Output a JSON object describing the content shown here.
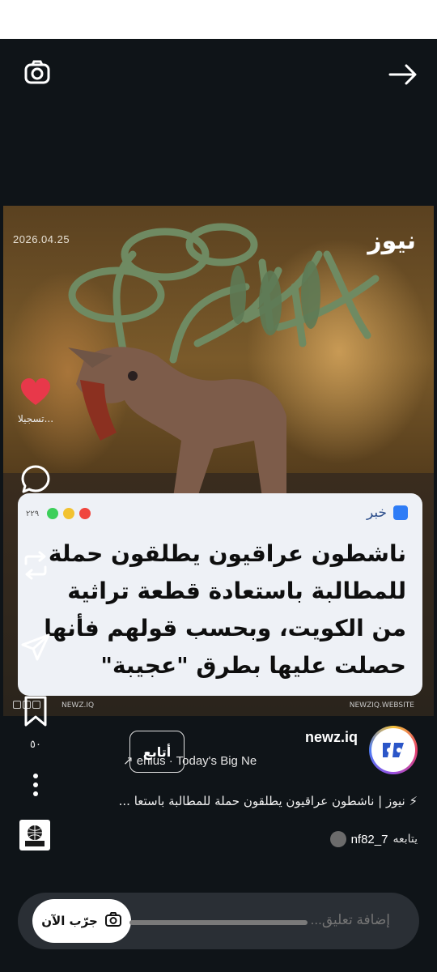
{
  "post": {
    "date": "2026.04.25",
    "brand": "نيوز",
    "card_tag": "خبر",
    "card_count": "٢٢٩",
    "headline": "ناشطون عراقيون يطلقون حملة للمطالبة باستعادة قطعة تراثية من الكويت، وبحسب قولهم فأنها حصلت عليها بطرق \"عجيبة\"",
    "footer_left": "NEWZ.IQ",
    "footer_right": "NEWZIQ.WEBSITE"
  },
  "rail": {
    "like_label": "تسجيلا...",
    "save_count": "٥٠"
  },
  "account": {
    "name": "newz.iq",
    "subtitle": "↗ enius · Today's Big Ne",
    "follow_label": "أتابع"
  },
  "caption": "⚡ نيوز | ناشطون عراقيون يطلقون حملة للمطالبة باستعا ...",
  "follows": {
    "text": "يتابعه",
    "user": "nf82_7"
  },
  "bottom": {
    "comment_placeholder": "إضافة تعليق...",
    "try_label": "جرّب الآن"
  },
  "colors": {
    "background": "#0f1418",
    "like": "#e8384a",
    "card": "#eef1f6",
    "tag_blue": "#2e7cf6"
  },
  "icons": [
    "camera-icon",
    "arrow-right-icon",
    "heart-icon",
    "comment-icon",
    "repost-icon",
    "send-icon",
    "bookmark-icon",
    "more-icon",
    "camera-small-icon"
  ]
}
